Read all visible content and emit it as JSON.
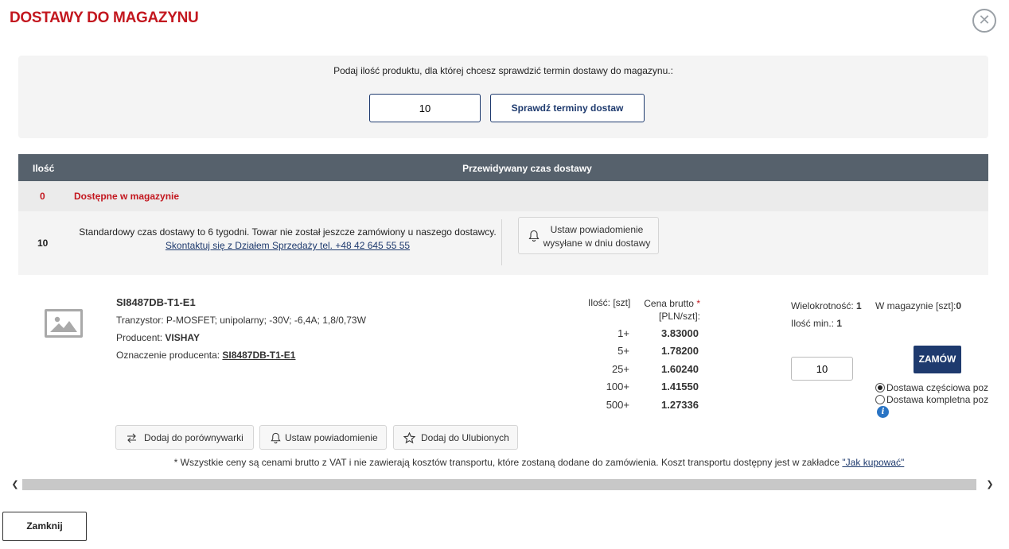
{
  "modal": {
    "title": "DOSTAWY DO MAGAZYNU",
    "close_icon": "close-icon"
  },
  "check": {
    "prompt": "Podaj ilość produktu, dla której chcesz sprawdzić termin dostawy do magazynu.:",
    "quantity_value": "10",
    "button_label": "Sprawdź terminy dostaw"
  },
  "table": {
    "header_qty": "Ilość",
    "header_time": "Przewidywany czas dostawy",
    "available_qty": "0",
    "available_text": "Dostępne w magazynie",
    "standard_qty": "10",
    "standard_text": "Standardowy czas dostawy to 6 tygodni. Towar nie został jeszcze zamówiony u naszego dostawcy.",
    "contact_link": "Skontaktuj się z Działem Sprzedaży tel. +48 42 645 55 55",
    "notify_line1": "Ustaw powiadomienie",
    "notify_line2": "wysyłane w dniu dostawy"
  },
  "product": {
    "image_icon": "image-placeholder-icon",
    "name": "SI8487DB-T1-E1",
    "description": "Tranzystor: P-MOSFET; unipolarny; -30V; -6,4A; 1,8/0,73W",
    "producer_label": "Producent: ",
    "producer": "VISHAY",
    "code_label": "Oznaczenie producenta: ",
    "code": "SI8487DB-T1-E1"
  },
  "pricing": {
    "qty_header": "Ilość: [szt]",
    "price_header": "Cena brutto",
    "price_star": "*",
    "price_unit": "[PLN/szt]:",
    "rows": [
      {
        "qty": "1+",
        "price": "3.83000"
      },
      {
        "qty": "5+",
        "price": "1.78200"
      },
      {
        "qty": "25+",
        "price": "1.60240"
      },
      {
        "qty": "100+",
        "price": "1.41550"
      },
      {
        "qty": "500+",
        "price": "1.27336"
      }
    ]
  },
  "order": {
    "multiplicity_label": "Wielokrotność: ",
    "multiplicity": "1",
    "instock_label": "W magazynie [szt]:",
    "instock": "0",
    "min_label": "Ilość min.: ",
    "min": "1",
    "quantity_value": "10",
    "button_label": "ZAMÓW",
    "option_partial": "Dostawa częściowa pozycji",
    "option_complete": "Dostawa kompletna pozycji",
    "info_icon": "info-icon"
  },
  "actions": {
    "compare": "Dodaj do porównywarki",
    "notify": "Ustaw powiadomienie",
    "favorite": "Dodaj do Ulubionych"
  },
  "footnote": {
    "text": "* Wszystkie ceny są cenami brutto z VAT i nie zawierają kosztów transportu, które zostaną dodane do zamówienia. Koszt transportu dostępny jest w zakładce ",
    "link": "\"Jak kupować\""
  },
  "footer": {
    "close_label": "Zamknij"
  }
}
